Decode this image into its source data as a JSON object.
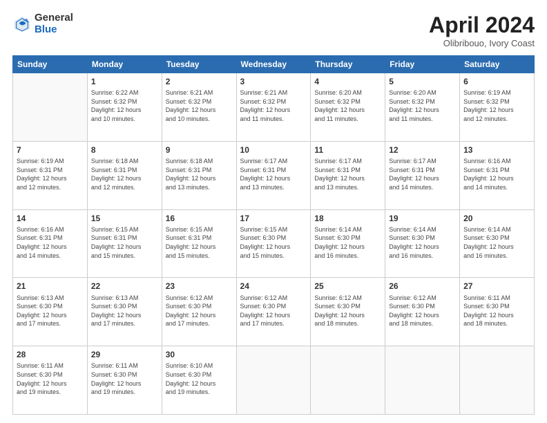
{
  "header": {
    "logo_general": "General",
    "logo_blue": "Blue",
    "title": "April 2024",
    "location": "Olibribouo, Ivory Coast"
  },
  "days_of_week": [
    "Sunday",
    "Monday",
    "Tuesday",
    "Wednesday",
    "Thursday",
    "Friday",
    "Saturday"
  ],
  "weeks": [
    [
      {
        "day": "",
        "info": ""
      },
      {
        "day": "1",
        "info": "Sunrise: 6:22 AM\nSunset: 6:32 PM\nDaylight: 12 hours\nand 10 minutes."
      },
      {
        "day": "2",
        "info": "Sunrise: 6:21 AM\nSunset: 6:32 PM\nDaylight: 12 hours\nand 10 minutes."
      },
      {
        "day": "3",
        "info": "Sunrise: 6:21 AM\nSunset: 6:32 PM\nDaylight: 12 hours\nand 11 minutes."
      },
      {
        "day": "4",
        "info": "Sunrise: 6:20 AM\nSunset: 6:32 PM\nDaylight: 12 hours\nand 11 minutes."
      },
      {
        "day": "5",
        "info": "Sunrise: 6:20 AM\nSunset: 6:32 PM\nDaylight: 12 hours\nand 11 minutes."
      },
      {
        "day": "6",
        "info": "Sunrise: 6:19 AM\nSunset: 6:32 PM\nDaylight: 12 hours\nand 12 minutes."
      }
    ],
    [
      {
        "day": "7",
        "info": "Sunrise: 6:19 AM\nSunset: 6:31 PM\nDaylight: 12 hours\nand 12 minutes."
      },
      {
        "day": "8",
        "info": "Sunrise: 6:18 AM\nSunset: 6:31 PM\nDaylight: 12 hours\nand 12 minutes."
      },
      {
        "day": "9",
        "info": "Sunrise: 6:18 AM\nSunset: 6:31 PM\nDaylight: 12 hours\nand 13 minutes."
      },
      {
        "day": "10",
        "info": "Sunrise: 6:17 AM\nSunset: 6:31 PM\nDaylight: 12 hours\nand 13 minutes."
      },
      {
        "day": "11",
        "info": "Sunrise: 6:17 AM\nSunset: 6:31 PM\nDaylight: 12 hours\nand 13 minutes."
      },
      {
        "day": "12",
        "info": "Sunrise: 6:17 AM\nSunset: 6:31 PM\nDaylight: 12 hours\nand 14 minutes."
      },
      {
        "day": "13",
        "info": "Sunrise: 6:16 AM\nSunset: 6:31 PM\nDaylight: 12 hours\nand 14 minutes."
      }
    ],
    [
      {
        "day": "14",
        "info": "Sunrise: 6:16 AM\nSunset: 6:31 PM\nDaylight: 12 hours\nand 14 minutes."
      },
      {
        "day": "15",
        "info": "Sunrise: 6:15 AM\nSunset: 6:31 PM\nDaylight: 12 hours\nand 15 minutes."
      },
      {
        "day": "16",
        "info": "Sunrise: 6:15 AM\nSunset: 6:31 PM\nDaylight: 12 hours\nand 15 minutes."
      },
      {
        "day": "17",
        "info": "Sunrise: 6:15 AM\nSunset: 6:30 PM\nDaylight: 12 hours\nand 15 minutes."
      },
      {
        "day": "18",
        "info": "Sunrise: 6:14 AM\nSunset: 6:30 PM\nDaylight: 12 hours\nand 16 minutes."
      },
      {
        "day": "19",
        "info": "Sunrise: 6:14 AM\nSunset: 6:30 PM\nDaylight: 12 hours\nand 16 minutes."
      },
      {
        "day": "20",
        "info": "Sunrise: 6:14 AM\nSunset: 6:30 PM\nDaylight: 12 hours\nand 16 minutes."
      }
    ],
    [
      {
        "day": "21",
        "info": "Sunrise: 6:13 AM\nSunset: 6:30 PM\nDaylight: 12 hours\nand 17 minutes."
      },
      {
        "day": "22",
        "info": "Sunrise: 6:13 AM\nSunset: 6:30 PM\nDaylight: 12 hours\nand 17 minutes."
      },
      {
        "day": "23",
        "info": "Sunrise: 6:12 AM\nSunset: 6:30 PM\nDaylight: 12 hours\nand 17 minutes."
      },
      {
        "day": "24",
        "info": "Sunrise: 6:12 AM\nSunset: 6:30 PM\nDaylight: 12 hours\nand 17 minutes."
      },
      {
        "day": "25",
        "info": "Sunrise: 6:12 AM\nSunset: 6:30 PM\nDaylight: 12 hours\nand 18 minutes."
      },
      {
        "day": "26",
        "info": "Sunrise: 6:12 AM\nSunset: 6:30 PM\nDaylight: 12 hours\nand 18 minutes."
      },
      {
        "day": "27",
        "info": "Sunrise: 6:11 AM\nSunset: 6:30 PM\nDaylight: 12 hours\nand 18 minutes."
      }
    ],
    [
      {
        "day": "28",
        "info": "Sunrise: 6:11 AM\nSunset: 6:30 PM\nDaylight: 12 hours\nand 19 minutes."
      },
      {
        "day": "29",
        "info": "Sunrise: 6:11 AM\nSunset: 6:30 PM\nDaylight: 12 hours\nand 19 minutes."
      },
      {
        "day": "30",
        "info": "Sunrise: 6:10 AM\nSunset: 6:30 PM\nDaylight: 12 hours\nand 19 minutes."
      },
      {
        "day": "",
        "info": ""
      },
      {
        "day": "",
        "info": ""
      },
      {
        "day": "",
        "info": ""
      },
      {
        "day": "",
        "info": ""
      }
    ]
  ]
}
